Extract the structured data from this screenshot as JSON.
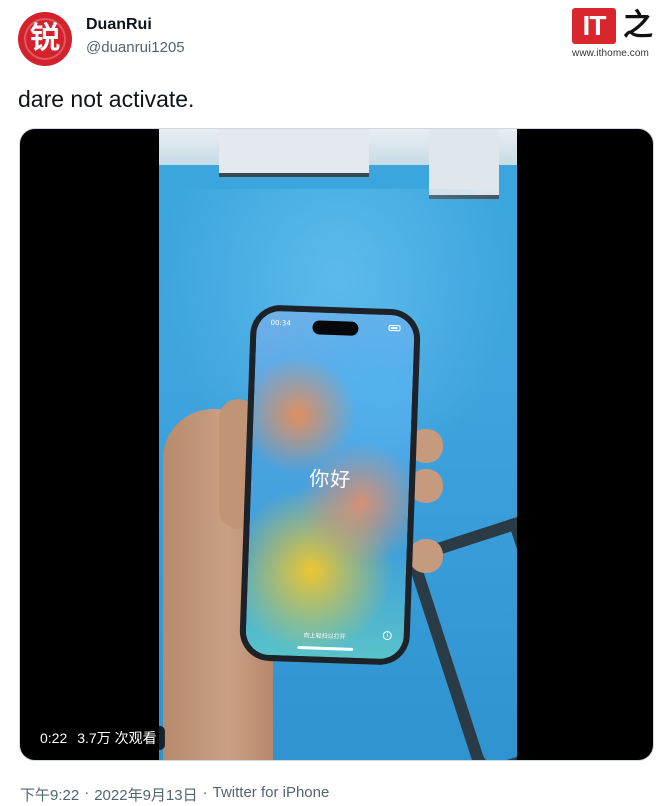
{
  "author": {
    "avatar_glyph": "锐",
    "display_name": "DuanRui",
    "handle": "@duanrui1205"
  },
  "watermark": {
    "logo_letters": "IT",
    "logo_char": "之家",
    "url": "www.ithome.com"
  },
  "tweet": {
    "text": "dare not activate."
  },
  "video": {
    "duration": "0:22",
    "views": "3.7万 次观看",
    "phone_status_time": "00:34",
    "phone_greeting": "你好",
    "phone_swipe_hint": "向上轻扫以打开"
  },
  "footer": {
    "time": "下午9:22",
    "separator": "·",
    "date": "2022年9月13日",
    "source": "Twitter for iPhone"
  },
  "colors": {
    "avatar_bg": "#d4222d",
    "logo_red": "#d9262e",
    "text_primary": "#0f1419",
    "text_secondary": "#536471"
  }
}
